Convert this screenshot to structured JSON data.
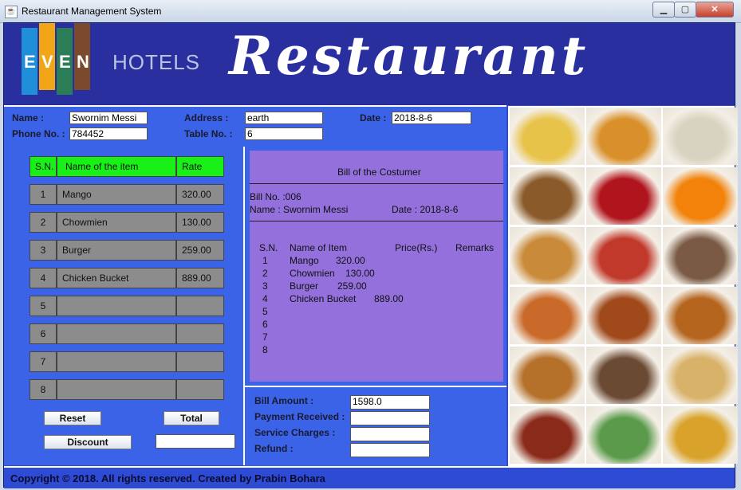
{
  "window": {
    "title": "Restaurant Management System",
    "icon": "java-cup-icon"
  },
  "header": {
    "logo": {
      "letters": [
        "E",
        "V",
        "E",
        "N"
      ],
      "word": "HOTELS",
      "colors": [
        "#1f8fd9",
        "#f2a516",
        "#2a7d57",
        "#7b4a2c"
      ]
    },
    "title": "Restaurant"
  },
  "customer": {
    "name_label": "Name :",
    "name_value": "Swornim Messi",
    "phone_label": "Phone No. :",
    "phone_value": "784452",
    "address_label": "Address :",
    "address_value": "earth",
    "table_label": "Table No. :",
    "table_value": "6",
    "date_label": "Date :",
    "date_value": "2018-8-6"
  },
  "order": {
    "headers": {
      "sn": "S.N.",
      "item": "Name of the item",
      "rate": "Rate"
    },
    "rows": [
      {
        "sn": "1",
        "item": "Mango",
        "rate": "320.00"
      },
      {
        "sn": "2",
        "item": "Chowmien",
        "rate": "130.00"
      },
      {
        "sn": "3",
        "item": "Burger",
        "rate": "259.00"
      },
      {
        "sn": "4",
        "item": "Chicken Bucket",
        "rate": "889.00"
      },
      {
        "sn": "5",
        "item": "",
        "rate": ""
      },
      {
        "sn": "6",
        "item": "",
        "rate": ""
      },
      {
        "sn": "7",
        "item": "",
        "rate": ""
      },
      {
        "sn": "8",
        "item": "",
        "rate": ""
      }
    ],
    "reset_label": "Reset",
    "total_label": "Total",
    "discount_label": "Discount",
    "discount_value": ""
  },
  "bill": {
    "title": "Bill of the Costumer",
    "bill_no": "Bill No. :006",
    "name": "Name : Swornim Messi",
    "date": "Date : 2018-8-6",
    "col_sn": "S.N.",
    "col_item": "Name of Item",
    "col_price": "Price(Rs.)",
    "col_remarks": "Remarks",
    "lines": [
      {
        "sn": "1",
        "item": "Mango",
        "price": "320.00"
      },
      {
        "sn": "2",
        "item": "Chowmien",
        "price": "130.00"
      },
      {
        "sn": "3",
        "item": "Burger",
        "price": "259.00"
      },
      {
        "sn": "4",
        "item": "Chicken Bucket",
        "price": "889.00"
      },
      {
        "sn": "5",
        "item": "",
        "price": ""
      },
      {
        "sn": "6",
        "item": "",
        "price": ""
      },
      {
        "sn": "7",
        "item": "",
        "price": ""
      },
      {
        "sn": "8",
        "item": "",
        "price": ""
      }
    ]
  },
  "totals": {
    "bill_amount_label": "Bill Amount :",
    "bill_amount_value": "1598.0",
    "payment_label": "Payment Received :",
    "payment_value": "",
    "service_label": "Service Charges :",
    "service_value": "",
    "refund_label": "Refund :",
    "refund_value": ""
  },
  "images": [
    {
      "name": "mango-icecream-image",
      "color": "#e8c34a"
    },
    {
      "name": "soup-image",
      "color": "#d9902a"
    },
    {
      "name": "momo-image",
      "color": "#d8d2c0"
    },
    {
      "name": "chowmien-image",
      "color": "#8a5a2a"
    },
    {
      "name": "coca-cola-image",
      "color": "#b0141c"
    },
    {
      "name": "fanta-image",
      "color": "#f2820a"
    },
    {
      "name": "burger-pepsi-image",
      "color": "#c98a3a"
    },
    {
      "name": "kfc-bucket-image",
      "color": "#c0392b"
    },
    {
      "name": "sausage-plate-image",
      "color": "#7a5a44"
    },
    {
      "name": "pizza-image",
      "color": "#c96a2a"
    },
    {
      "name": "roast-chicken-image",
      "color": "#a04a1c"
    },
    {
      "name": "cheese-burger-image",
      "color": "#b5651d"
    },
    {
      "name": "fried-fish-image",
      "color": "#b5702a"
    },
    {
      "name": "coffee-cup-image",
      "color": "#6b4a34"
    },
    {
      "name": "spring-rolls-image",
      "color": "#d9b26a"
    },
    {
      "name": "chilli-chicken-image",
      "color": "#8a2a1a"
    },
    {
      "name": "salad-image",
      "color": "#5a9a4a"
    },
    {
      "name": "curry-image",
      "color": "#d9a22a"
    }
  ],
  "footer": {
    "copyright": "Copyright © 2018. All rights reserved. Created by Prabin Bohara"
  }
}
